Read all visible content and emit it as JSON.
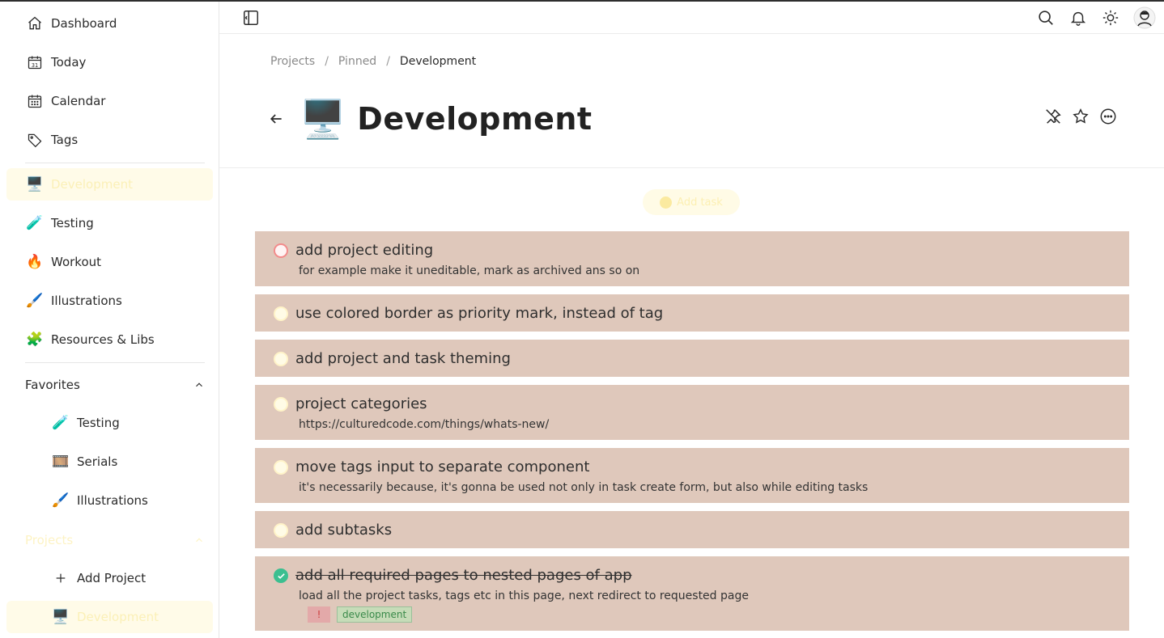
{
  "sidebar": {
    "main_items": [
      {
        "label": "Dashboard",
        "icon": "home-icon"
      },
      {
        "label": "Today",
        "icon": "calendar-31-icon"
      },
      {
        "label": "Calendar",
        "icon": "calendar-icon"
      },
      {
        "label": "Tags",
        "icon": "tag-icon"
      }
    ],
    "projects_quick": [
      {
        "label": "Development",
        "emoji": "🖥️"
      },
      {
        "label": "Testing",
        "emoji": "🧪"
      },
      {
        "label": "Workout",
        "emoji": "🔥"
      },
      {
        "label": "Illustrations",
        "emoji": "🖌️"
      },
      {
        "label": "Resources & Libs",
        "emoji": "🧩"
      }
    ],
    "favorites": {
      "title": "Favorites",
      "items": [
        {
          "label": "Testing",
          "emoji": "🧪"
        },
        {
          "label": "Serials",
          "emoji": "🎞️"
        },
        {
          "label": "Illustrations",
          "emoji": "🖌️"
        }
      ]
    },
    "projects": {
      "title": "Projects",
      "add_label": "Add Project",
      "items": [
        {
          "label": "Development",
          "emoji": "🖥️"
        }
      ]
    }
  },
  "topbar": {
    "icons": [
      "sidebar-toggle-icon",
      "search-icon",
      "bell-icon",
      "sun-icon",
      "avatar"
    ]
  },
  "breadcrumb": [
    "Projects",
    "Pinned",
    "Development"
  ],
  "page": {
    "emoji": "🖥️",
    "title": "Development",
    "add_task_label": "Add task"
  },
  "tasks": [
    {
      "name": "add project editing",
      "desc": "for example make it uneditable, mark as archived ans so on",
      "status": "high-priority"
    },
    {
      "name": "use colored border as priority mark, instead of tag",
      "desc": "",
      "status": "open"
    },
    {
      "name": "add project and task theming",
      "desc": "",
      "status": "open"
    },
    {
      "name": "project categories",
      "desc": "https://culturedcode.com/things/whats-new/",
      "status": "open"
    },
    {
      "name": "move tags input to separate component",
      "desc": "it's necessarily because, it's gonna be used not only in task create form, but also while editing tasks",
      "status": "open"
    },
    {
      "name": "add subtasks",
      "desc": "",
      "status": "open"
    },
    {
      "name": "add all required pages to nested pages of app",
      "desc": "load all the project tasks, tags etc in this page, next redirect to requested page",
      "status": "done",
      "priority_label": "!",
      "tag": "development"
    }
  ],
  "colors": {
    "task_bg": "#dfc8bb",
    "accent_yellow": "#fbf0b7",
    "done_green": "#3cbf90",
    "priority_red": "#f28b8b"
  }
}
